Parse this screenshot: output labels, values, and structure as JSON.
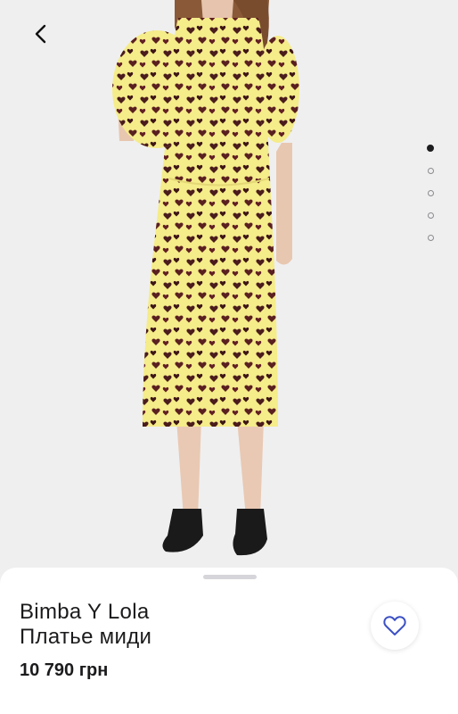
{
  "product": {
    "brand": "Bimba Y Lola",
    "name": "Платье миди",
    "price": "10 790 грн"
  },
  "gallery": {
    "image_count": 5,
    "active_index": 0
  },
  "icons": {
    "back": "chevron-left-icon",
    "favorite": "heart-outline-icon"
  },
  "colors": {
    "favorite_accent": "#3b50c4",
    "dress_yellow": "#f5ec8a",
    "background": "#efeff0"
  }
}
